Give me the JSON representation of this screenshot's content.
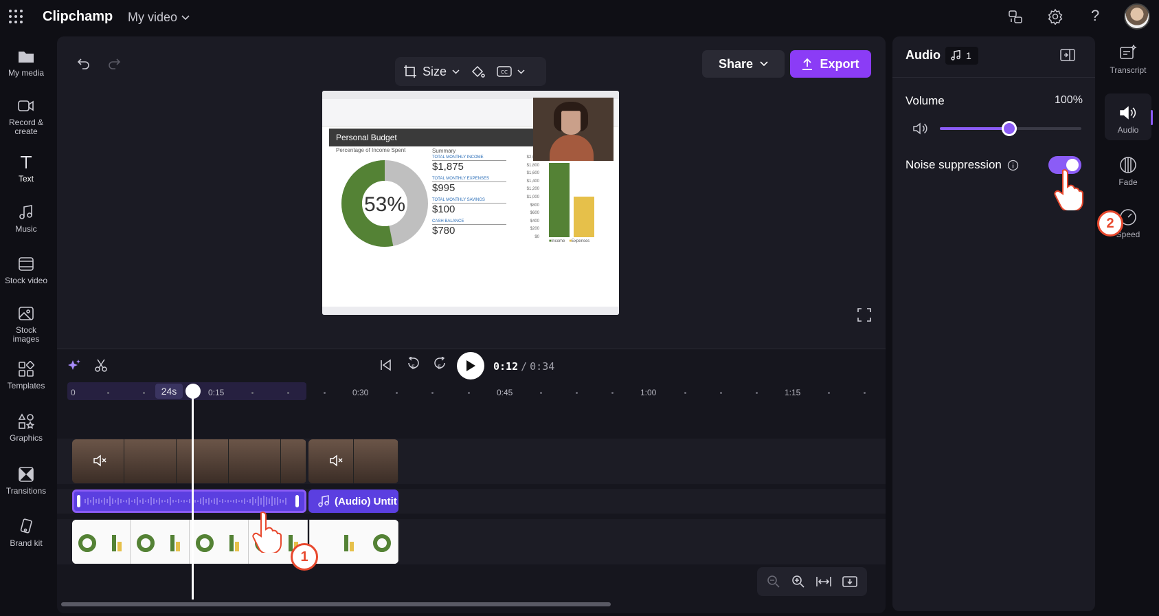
{
  "app": {
    "name": "Clipchamp",
    "project_name": "My video"
  },
  "left_nav": [
    {
      "label": "My media",
      "icon": "folder-icon"
    },
    {
      "label": "Record & create",
      "icon": "camera-icon"
    },
    {
      "label": "Text",
      "icon": "text-icon"
    },
    {
      "label": "Music",
      "icon": "music-icon"
    },
    {
      "label": "Stock video",
      "icon": "film-icon"
    },
    {
      "label": "Stock images",
      "icon": "image-icon"
    },
    {
      "label": "Templates",
      "icon": "templates-icon"
    },
    {
      "label": "Graphics",
      "icon": "graphics-icon"
    },
    {
      "label": "Transitions",
      "icon": "transitions-icon"
    },
    {
      "label": "Brand kit",
      "icon": "brandkit-icon"
    }
  ],
  "toolbar": {
    "size_label": "Size",
    "share_label": "Share",
    "export_label": "Export"
  },
  "preview": {
    "sheet_title": "Personal Budget",
    "chart_title": "Percentage of Income Spent",
    "donut_value": "53%",
    "summary_heading": "Summary",
    "summary": [
      {
        "label": "TOTAL MONTHLY INCOME",
        "value": "$1,875"
      },
      {
        "label": "TOTAL MONTHLY EXPENSES",
        "value": "$995"
      },
      {
        "label": "TOTAL MONTHLY SAVINGS",
        "value": "$100"
      },
      {
        "label": "CASH BALANCE",
        "value": "$780"
      }
    ],
    "bar_axis": [
      "$2,000",
      "$1,800",
      "$1,600",
      "$1,400",
      "$1,200",
      "$1,000",
      "$800",
      "$600",
      "$400",
      "$200",
      "$0"
    ],
    "legend": [
      "Income",
      "Expenses"
    ],
    "colors": {
      "income": "#548235",
      "expenses": "#e6c04a",
      "donut_rest": "#bfbfbf"
    }
  },
  "playback": {
    "current": "0:12",
    "separator": "/",
    "total": "0:34",
    "skip_back": "5",
    "skip_fwd": "5"
  },
  "ruler": {
    "start": "0",
    "playhead": "24s",
    "marks": [
      "0:15",
      "0:30",
      "0:45",
      "1:00",
      "1:15"
    ]
  },
  "tracks": {
    "audio_clip_label": "(Audio) Untit"
  },
  "panel": {
    "title": "Audio",
    "badge_count": "1",
    "volume_label": "Volume",
    "volume_value": "100%",
    "volume_fraction": 0.49,
    "noise_label": "Noise suppression",
    "noise_on": true
  },
  "right_rail": [
    {
      "label": "Transcript",
      "icon": "transcript-icon"
    },
    {
      "label": "Audio",
      "icon": "speaker-icon"
    },
    {
      "label": "Fade",
      "icon": "fade-icon"
    },
    {
      "label": "Speed",
      "icon": "speed-icon"
    }
  ],
  "callouts": [
    "1",
    "2"
  ],
  "theme": {
    "accent": "#8b3cf6",
    "bg": "#0f0f15",
    "panel": "#1b1b24"
  }
}
